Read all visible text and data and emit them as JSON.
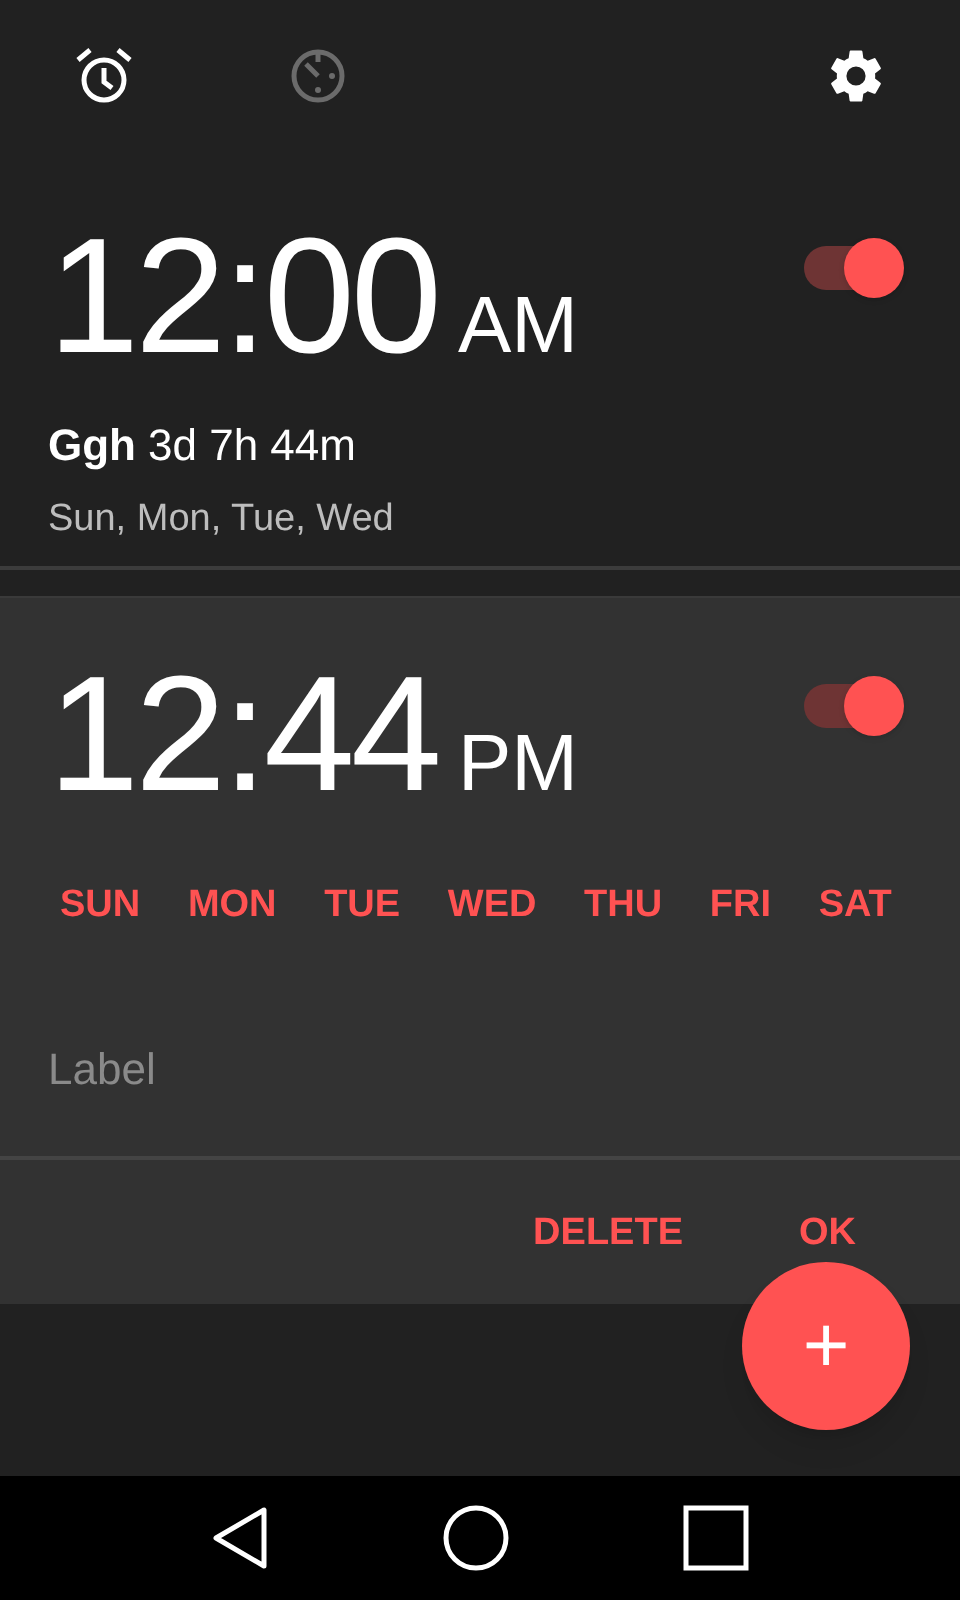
{
  "tabs": [
    {
      "kind": "alarm",
      "selected": true
    },
    {
      "kind": "timer",
      "selected": false
    }
  ],
  "alarms": [
    {
      "time": "12:00",
      "ampm": "AM",
      "on": true,
      "expanded": false,
      "label": "Ggh",
      "countdown": "3d 7h 44m",
      "repeat": "Sun, Mon, Tue, Wed"
    },
    {
      "time": "12:44",
      "ampm": "PM",
      "on": true,
      "expanded": true,
      "days": [
        "SUN",
        "MON",
        "TUE",
        "WED",
        "THU",
        "FRI",
        "SAT"
      ],
      "label_placeholder": "Label",
      "actions": [
        "DELETE",
        "OK"
      ]
    }
  ],
  "fab": {
    "label": "+"
  }
}
